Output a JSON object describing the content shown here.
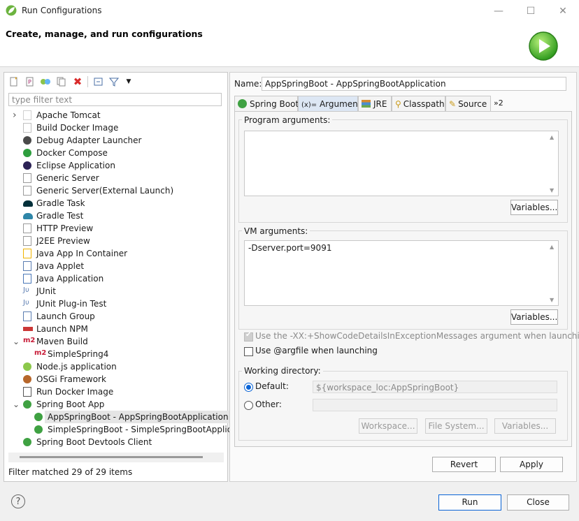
{
  "window": {
    "title": "Run Configurations",
    "minimize": "—",
    "maximize": "☐",
    "close": "✕"
  },
  "header": {
    "title": "Create, manage, and run configurations"
  },
  "left": {
    "filter_placeholder": "type filter text",
    "status": "Filter matched 29 of 29 items",
    "tree": [
      {
        "label": "Apache Tomcat",
        "icon": "tomcat-icon",
        "chevron": "›",
        "selected": false
      },
      {
        "label": "Build Docker Image",
        "icon": "docker-icon",
        "chevron": "",
        "selected": false
      },
      {
        "label": "Debug Adapter Launcher",
        "icon": "debug-adapter-icon",
        "chevron": "",
        "selected": false
      },
      {
        "label": "Docker Compose",
        "icon": "docker-compose-icon",
        "chevron": "",
        "selected": false
      },
      {
        "label": "Eclipse Application",
        "icon": "eclipse-icon",
        "chevron": "",
        "selected": false
      },
      {
        "label": "Generic Server",
        "icon": "server-icon",
        "chevron": "",
        "selected": false
      },
      {
        "label": "Generic Server(External Launch)",
        "icon": "server-icon",
        "chevron": "",
        "selected": false
      },
      {
        "label": "Gradle Task",
        "icon": "gradle-icon",
        "chevron": "",
        "selected": false
      },
      {
        "label": "Gradle Test",
        "icon": "gradle-test-icon",
        "chevron": "",
        "selected": false
      },
      {
        "label": "HTTP Preview",
        "icon": "server-icon",
        "chevron": "",
        "selected": false
      },
      {
        "label": "J2EE Preview",
        "icon": "server-icon",
        "chevron": "",
        "selected": false
      },
      {
        "label": "Java App In Container",
        "icon": "java-container-icon",
        "chevron": "",
        "selected": false
      },
      {
        "label": "Java Applet",
        "icon": "applet-icon",
        "chevron": "",
        "selected": false
      },
      {
        "label": "Java Application",
        "icon": "java-app-icon",
        "chevron": "",
        "selected": false
      },
      {
        "label": "JUnit",
        "icon": "junit-icon",
        "chevron": "",
        "selected": false
      },
      {
        "label": "JUnit Plug-in Test",
        "icon": "junit-plugin-icon",
        "chevron": "",
        "selected": false
      },
      {
        "label": "Launch Group",
        "icon": "launch-group-icon",
        "chevron": "",
        "selected": false
      },
      {
        "label": "Launch NPM",
        "icon": "npm-icon",
        "chevron": "",
        "selected": false
      },
      {
        "label": "Maven Build",
        "icon": "maven-icon",
        "chevron": "⌄",
        "selected": false
      },
      {
        "label": "SimpleSpring4",
        "icon": "maven-icon",
        "chevron": "",
        "selected": false,
        "child": true
      },
      {
        "label": "Node.js application",
        "icon": "nodejs-icon",
        "chevron": "",
        "selected": false
      },
      {
        "label": "OSGi Framework",
        "icon": "osgi-icon",
        "chevron": "",
        "selected": false
      },
      {
        "label": "Run Docker Image",
        "icon": "docker-run-icon",
        "chevron": "",
        "selected": false
      },
      {
        "label": "Spring Boot App",
        "icon": "spring-boot-icon",
        "chevron": "⌄",
        "selected": false
      },
      {
        "label": "AppSpringBoot - AppSpringBootApplication",
        "icon": "spring-boot-icon",
        "chevron": "",
        "selected": true,
        "child": true
      },
      {
        "label": "SimpleSpringBoot - SimpleSpringBootApplicat",
        "icon": "spring-boot-icon",
        "chevron": "",
        "selected": false,
        "child": true
      },
      {
        "label": "Spring Boot Devtools Client",
        "icon": "spring-devtools-icon",
        "chevron": "",
        "selected": false
      }
    ]
  },
  "right": {
    "name_label": "Name:",
    "name_value": "AppSpringBoot - AppSpringBootApplication",
    "tabs": [
      {
        "label": "Spring Boot",
        "icon": "spring-boot-icon"
      },
      {
        "label": "Arguments",
        "icon": "arguments-icon",
        "prefix": "(x)="
      },
      {
        "label": "JRE",
        "icon": "jre-icon"
      },
      {
        "label": "Classpath",
        "icon": "classpath-icon"
      },
      {
        "label": "Source",
        "icon": "source-icon"
      },
      {
        "label": "»2",
        "icon": "more-tabs-icon"
      }
    ],
    "program_args_label": "Program arguments:",
    "program_args_value": "",
    "variables_label": "Variables...",
    "vm_args_label": "VM arguments:",
    "vm_args_value": "-Dserver.port=9091",
    "show_code_details_label": "Use the -XX:+ShowCodeDetailsInExceptionMessages argument when launching",
    "argfile_label": "Use @argfile when launching",
    "working_dir_label": "Working directory:",
    "default_label": "Default:",
    "default_value": "${workspace_loc:AppSpringBoot}",
    "other_label": "Other:",
    "workspace_btn": "Workspace...",
    "filesystem_btn": "File System...",
    "variables_btn": "Variables...",
    "revert_btn": "Revert",
    "apply_btn": "Apply"
  },
  "footer": {
    "run_btn": "Run",
    "close_btn": "Close",
    "help": "?"
  },
  "colors": {
    "accent": "#0a64d6",
    "spring": "#3fa142",
    "selection": "#e5e5e5"
  }
}
